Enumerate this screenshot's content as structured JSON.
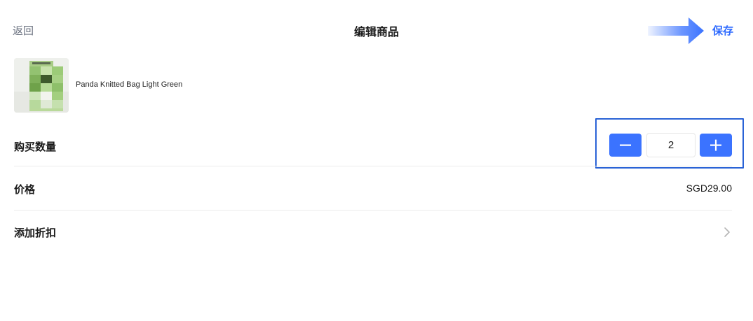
{
  "header": {
    "back_label": "返回",
    "title": "编辑商品",
    "save_label": "保存"
  },
  "product": {
    "name": "Panda Knitted Bag Light Green",
    "image_icon": "product-thumbnail"
  },
  "quantity": {
    "label": "购买数量",
    "value": "2",
    "decrement_icon": "minus-icon",
    "increment_icon": "plus-icon"
  },
  "price": {
    "label": "价格",
    "value": "SGD29.00"
  },
  "discount": {
    "label": "添加折扣",
    "chevron_icon": "chevron-right-icon"
  },
  "colors": {
    "accent": "#3b73ff",
    "save_text": "#2f6bff",
    "highlight_border": "#2a63d6",
    "divider": "#ececec"
  }
}
